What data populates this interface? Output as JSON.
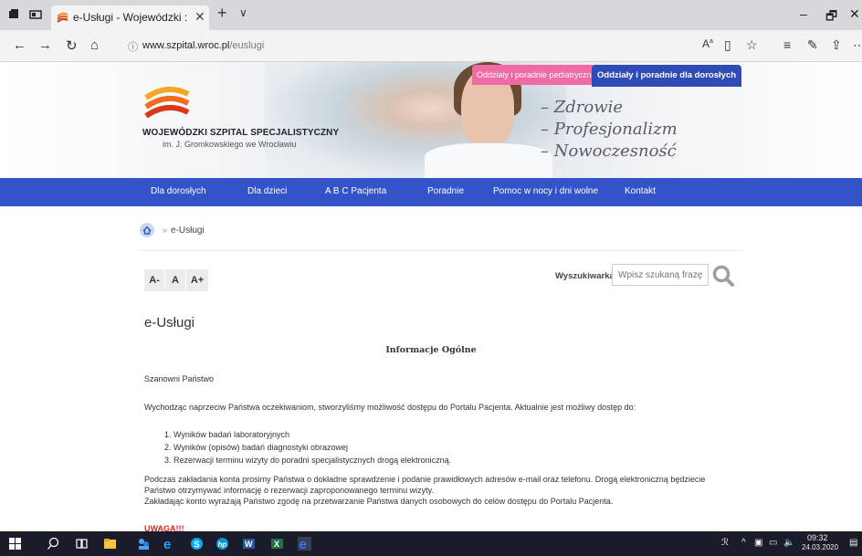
{
  "browser": {
    "tab_title": "e-Usługi - Wojewódzki :",
    "tab_close": "✕",
    "new_tab": "+",
    "tab_menu": "∨",
    "url_host": "www.szpital.wroc.pl",
    "url_path": "/euslugi",
    "win_min": "–",
    "win_max": "🗗",
    "win_close": "✕"
  },
  "header": {
    "logo_title": "WOJEWÓDZKI SZPITAL SPECJALISTYCZNY",
    "logo_subtitle": "im. J. Gromkowskiego we Wrocławiu",
    "slogans": [
      "– Zdrowie",
      "– Profesjonalizm",
      "– Nowoczesność"
    ],
    "tab_pediatric": "Oddziały i poradnie pediatryczne",
    "tab_adults": "Oddziały i poradnie dla dorosłych"
  },
  "menu": [
    "Dla dorosłych",
    "Dla dzieci",
    "A B C Pacjenta",
    "Poradnie",
    "Pomoc w nocy i dni wolne",
    "Kontakt"
  ],
  "breadcrumb": {
    "separator": "»",
    "current": "e-Usługi"
  },
  "font_controls": [
    "A-",
    "A",
    "A+"
  ],
  "search": {
    "label": "Wyszukiwarka",
    "placeholder": "Wpisz szukaną frazę..."
  },
  "content": {
    "title": "e-Usługi",
    "heading": "Informacje Ogólne",
    "greeting": "Szanowni Państwo",
    "intro": "Wychodząc naprzeciw Państwa oczekiwaniom, stworzyliśmy możliwość dostępu do Portalu Pacjenta. Aktualnie jest możliwy dostęp do:",
    "list": [
      "1.  Wyników badań laboratoryjnych",
      "2.  Wyników (opisów) badań diagnostyki obrazowej",
      "3.  Rezerwacji terminu wizyty do poradni specjalistycznych drogą elektroniczną."
    ],
    "para1_line1": "Podczas zakładania konta prosimy Państwa o dokładne sprawdzenie i podanie prawidłowych adresów e-mail oraz telefonu. Drogą elektroniczną będziecie",
    "para1_line2": "Państwo otrzymywać informację o rezerwacji zaproponowanego terminu wizyty.",
    "para2": "Zakładając konto wyrażają Państwo zgodę na przetwarzanie Państwa danych osobowych do celów dostępu do Portalu Pacjenta.",
    "warning": "UWAGA!!!"
  },
  "taskbar": {
    "time": "09:32",
    "date": "24.03.2020"
  }
}
